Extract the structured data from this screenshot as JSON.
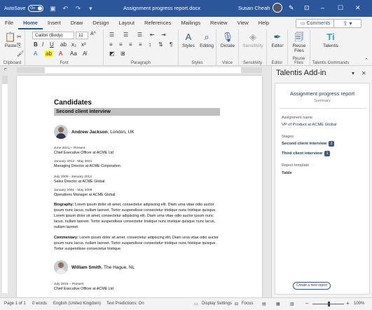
{
  "titlebar": {
    "autosave_label": "AutoSave",
    "autosave_state": "On",
    "doc_title": "Assignment progress report.docx",
    "user_name": "Susan Cheah"
  },
  "tabs": [
    "File",
    "Home",
    "Insert",
    "Draw",
    "Design",
    "Layout",
    "References",
    "Mailings",
    "Review",
    "View",
    "Help"
  ],
  "comments_label": "Comments",
  "ribbon": {
    "paste_label": "Paste",
    "font_name": "Calibri (Body)",
    "font_size": "11",
    "styles_label": "Styles",
    "editing_label": "Editing",
    "dictate_label": "Dictate",
    "sensitivity_label": "Sensitivity",
    "editor_label": "Editor",
    "reuse_files_label": "Reuse Files",
    "talentis_label": "Talentis",
    "groups": {
      "clipboard": "Clipboard",
      "font": "Font",
      "paragraph": "Paragraph",
      "styles": "Styles",
      "voice": "Voice",
      "sensitivity": "Sensitivity",
      "editor": "Editor",
      "reuse_files": "Reuse Files",
      "talentis_commands": "Talentis Commands"
    }
  },
  "document": {
    "heading": "Candidates",
    "section_bar": "Second client interview",
    "candidate1": {
      "name": "Andrew Jackson",
      "location": ", London, UK",
      "jobs": [
        {
          "dates": "June 2021 – Present",
          "title": "Chief Executive Officer at ACME Ltd"
        },
        {
          "dates": "January 2013 - May 2021",
          "title": "Managing Director at ACME Corporation"
        },
        {
          "dates": "July 2009 - January 2013",
          "title": "Sales Director at ACME Global"
        },
        {
          "dates": "January 2001 - May 2009",
          "title": "Operations Manager at ACME Global"
        }
      ],
      "biography_label": "Biography:",
      "biography": " Lorem ipsum dolor sit amet, consectetur adipiscing elit. Diam urna vitae odio auctor ipsum nunc lacus, nullam laoreet. Tortor suspendisse consectetur tristique nunc tristique quisque. Lorem ipsum dolor sit amet, consectetur adipiscing elit. Diam urna vitae odio auctor ipsum nunc lacus, nullam laoreet. Tortor suspendisse consectetur tristique nunc tristique quisque nunc lacus, nullam laoreet.",
      "commentary_label": "Commentary:",
      "commentary": " Lorem ipsum dolor sit amet, consectetur adipiscing elit. Diam urna vitae odio auctor ipsum nunc lacus, nullam laoreet. Tortor suspendisse consectetur tristique nunc tristique quisque. Tortor suspendisse consectetur tristique."
    },
    "candidate2": {
      "name": "William Smith",
      "location": ", The Hague, NL",
      "jobs": [
        {
          "dates": "July 2015 – Present",
          "title": "Chief Executive Officer at ACME Ltd"
        }
      ]
    }
  },
  "pane": {
    "title": "Talentis Add-in",
    "card_title": "Assignment progress report",
    "card_subtitle": "Summary",
    "assignment_label": "Assignment name",
    "assignment_value": "VP of Product at ACME Global",
    "stages_label": "Stages",
    "stages": [
      {
        "name": "Second client interview",
        "count": "2"
      },
      {
        "name": "Third client interview",
        "count": "1"
      }
    ],
    "template_label": "Report template",
    "template_value": "Table",
    "create_button": "Create a new report"
  },
  "status": {
    "page": "Page 1 of 1",
    "words": "0 words",
    "language": "English (United Kingdom)",
    "predictions": "Text Predictions: On",
    "display_settings": "Display Settings",
    "focus": "Focus",
    "zoom": "100%",
    "zoom_level_percent": 100
  },
  "colors": {
    "word_blue": "#2b579a",
    "pane_navy": "#1f3a5f",
    "section_bar": "#bfbfbf"
  }
}
